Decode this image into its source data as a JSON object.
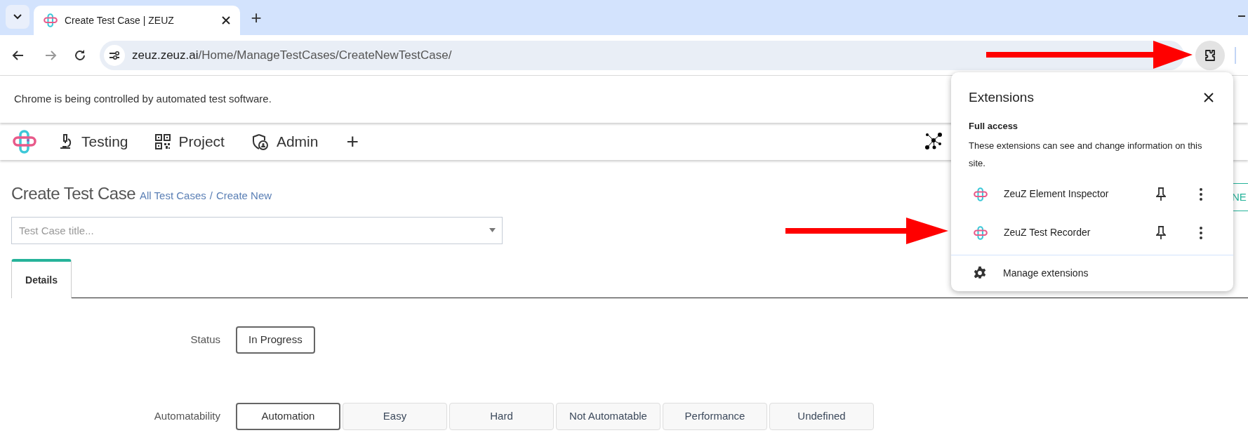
{
  "browser": {
    "tabs": [
      {
        "title": "Create Test Case | ZEUZ",
        "selected": true
      }
    ],
    "new_tab": "+",
    "url_host": "zeuz.zeuz.ai",
    "url_path": "/Home/ManageTestCases/CreateNewTestCase/"
  },
  "infobar": {
    "message": "Chrome is being controlled by automated test software."
  },
  "nav": {
    "items": [
      {
        "label": "Testing"
      },
      {
        "label": "Project"
      },
      {
        "label": "Admin"
      }
    ],
    "add": "+"
  },
  "page": {
    "title": "Create Test Case",
    "breadcrumb": [
      "All Test Cases",
      "Create New"
    ],
    "separator": "/"
  },
  "title_field": {
    "placeholder": "Test Case title..."
  },
  "new_button": {
    "label": "NE"
  },
  "tabs": [
    {
      "label": "Details",
      "selected": true
    }
  ],
  "status": {
    "label": "Status",
    "value": "In Progress"
  },
  "automatability": {
    "label": "Automatability",
    "options": [
      {
        "label": "Automation",
        "selected": true
      },
      {
        "label": "Easy",
        "selected": false
      },
      {
        "label": "Hard",
        "selected": false
      },
      {
        "label": "Not Automatable",
        "selected": false
      },
      {
        "label": "Performance",
        "selected": false
      },
      {
        "label": "Undefined",
        "selected": false
      }
    ]
  },
  "extensions_popup": {
    "title": "Extensions",
    "section": "Full access",
    "description": "These extensions can see and change information on this site.",
    "extensions": [
      {
        "name": "ZeuZ Element Inspector"
      },
      {
        "name": "ZeuZ Test Recorder"
      }
    ],
    "manage": "Manage extensions"
  }
}
